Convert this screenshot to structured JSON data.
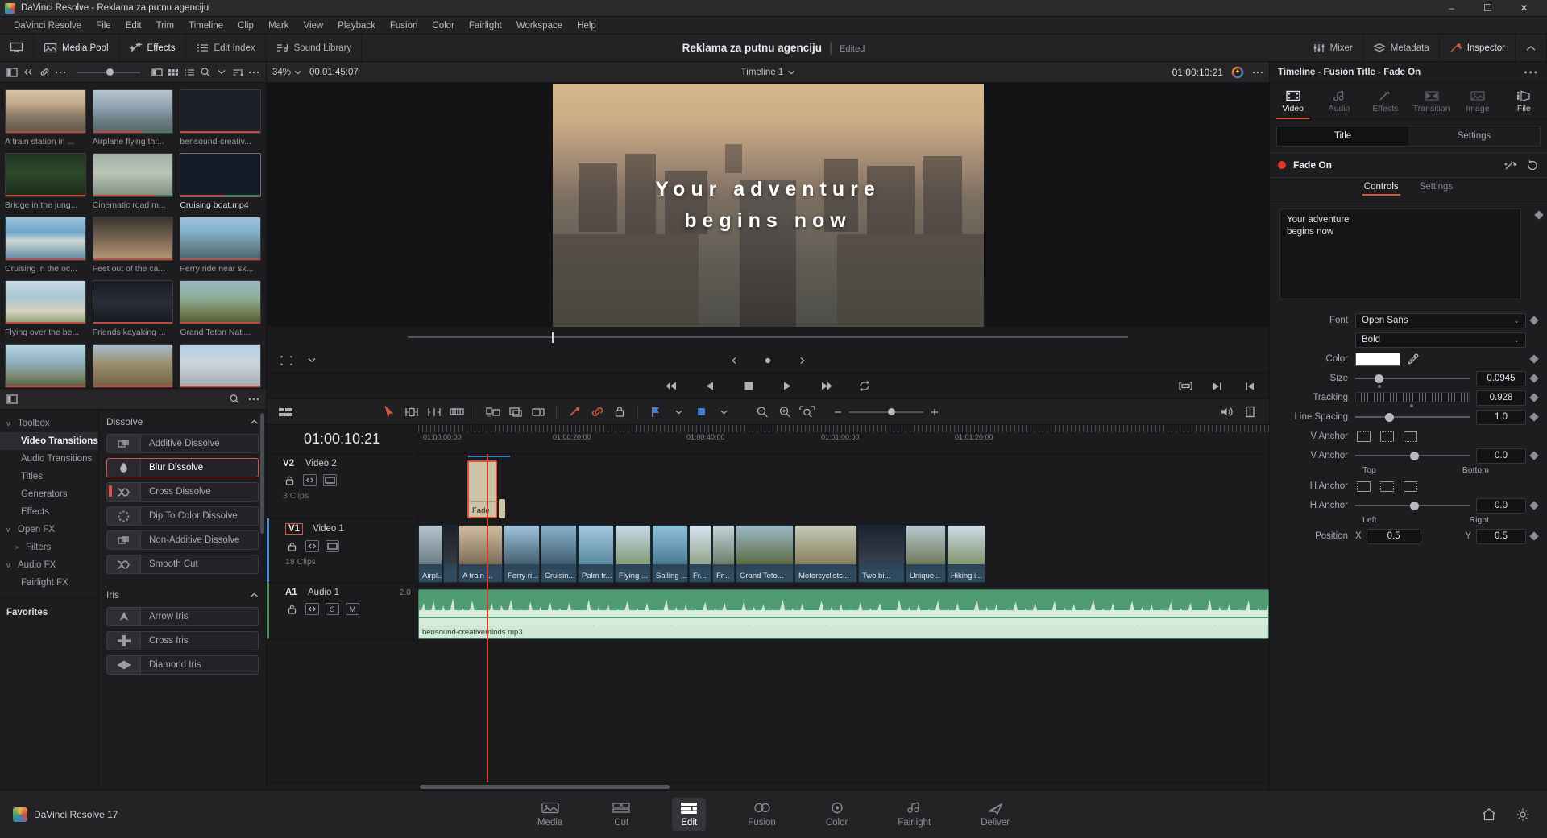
{
  "window": {
    "title": "DaVinci Resolve - Reklama za putnu agenciju",
    "minimize": "–",
    "maximize": "☐",
    "close": "✕"
  },
  "menubar": [
    "DaVinci Resolve",
    "File",
    "Edit",
    "Trim",
    "Timeline",
    "Clip",
    "Mark",
    "View",
    "Playback",
    "Fusion",
    "Color",
    "Fairlight",
    "Workspace",
    "Help"
  ],
  "apptoolbar": {
    "items": [
      {
        "label": "",
        "icon": "viewer-icon",
        "active": false
      },
      {
        "label": "Media Pool",
        "icon": "media-pool-icon",
        "active": true
      },
      {
        "label": "Effects",
        "icon": "effects-icon",
        "active": true
      },
      {
        "label": "Edit Index",
        "icon": "edit-index-icon",
        "active": false
      },
      {
        "label": "Sound Library",
        "icon": "sound-library-icon",
        "active": false
      }
    ],
    "right_items": [
      {
        "label": "Mixer",
        "icon": "mixer-icon"
      },
      {
        "label": "Metadata",
        "icon": "metadata-icon"
      },
      {
        "label": "Inspector",
        "icon": "inspector-icon"
      }
    ],
    "project_name": "Reklama za putnu agenciju",
    "project_status": "Edited"
  },
  "media_pool": {
    "zoom": "34%",
    "clips": [
      {
        "name": "A train station in ...",
        "selected": false
      },
      {
        "name": "Airplane flying thr...",
        "selected": false
      },
      {
        "name": "bensound-creativ...",
        "selected": false
      },
      {
        "name": "Bridge in the jung...",
        "selected": false
      },
      {
        "name": "Cinematic road m...",
        "selected": false
      },
      {
        "name": "Cruising boat.mp4",
        "selected": true
      },
      {
        "name": "Cruising in the oc...",
        "selected": false
      },
      {
        "name": "Feet out of the ca...",
        "selected": false
      },
      {
        "name": "Ferry ride near sk...",
        "selected": false
      },
      {
        "name": "Flying over the be...",
        "selected": false
      },
      {
        "name": "Friends kayaking ...",
        "selected": false
      },
      {
        "name": "Grand Teton Nati...",
        "selected": false
      }
    ]
  },
  "effects_library": {
    "tree": [
      {
        "label": "Toolbox",
        "level": 0,
        "chevron": "v",
        "selected": false
      },
      {
        "label": "Video Transitions",
        "level": 1,
        "chevron": "",
        "selected": true
      },
      {
        "label": "Audio Transitions",
        "level": 1,
        "chevron": "",
        "selected": false
      },
      {
        "label": "Titles",
        "level": 1,
        "chevron": "",
        "selected": false
      },
      {
        "label": "Generators",
        "level": 1,
        "chevron": "",
        "selected": false
      },
      {
        "label": "Effects",
        "level": 1,
        "chevron": "",
        "selected": false
      },
      {
        "label": "Open FX",
        "level": 0,
        "chevron": "v",
        "selected": false
      },
      {
        "label": "Filters",
        "level": 1,
        "chevron": ">",
        "selected": false
      },
      {
        "label": "Audio FX",
        "level": 0,
        "chevron": "v",
        "selected": false
      },
      {
        "label": "Fairlight FX",
        "level": 1,
        "chevron": "",
        "selected": false
      }
    ],
    "favorites_label": "Favorites",
    "categories": [
      {
        "name": "Dissolve",
        "items": [
          {
            "label": "Additive Dissolve",
            "icon": "additive-dissolve-icon",
            "selected": false,
            "marker": false
          },
          {
            "label": "Blur Dissolve",
            "icon": "blur-dissolve-icon",
            "selected": true,
            "marker": false
          },
          {
            "label": "Cross Dissolve",
            "icon": "cross-dissolve-icon",
            "selected": false,
            "marker": true
          },
          {
            "label": "Dip To Color Dissolve",
            "icon": "dip-to-color-icon",
            "selected": false,
            "marker": false
          },
          {
            "label": "Non-Additive Dissolve",
            "icon": "non-additive-icon",
            "selected": false,
            "marker": false
          },
          {
            "label": "Smooth Cut",
            "icon": "smooth-cut-icon",
            "selected": false,
            "marker": false
          }
        ]
      },
      {
        "name": "Iris",
        "items": [
          {
            "label": "Arrow Iris",
            "icon": "arrow-iris-icon",
            "selected": false,
            "marker": false
          },
          {
            "label": "Cross Iris",
            "icon": "cross-iris-icon",
            "selected": false,
            "marker": false
          },
          {
            "label": "Diamond Iris",
            "icon": "diamond-iris-icon",
            "selected": false,
            "marker": false
          }
        ]
      }
    ]
  },
  "viewer": {
    "zoom": "34%",
    "duration_tc": "00:01:45:07",
    "timeline_name": "Timeline 1",
    "current_tc": "01:00:10:21",
    "title_line1": "Your adventure",
    "title_line2": "begins now"
  },
  "timeline": {
    "timecode": "01:00:10:21",
    "ruler_labels": [
      "01:00:00:00",
      "01:00:20:00",
      "01:00:40:00",
      "01:01:00:00",
      "01:01:20:00"
    ],
    "tracks": [
      {
        "id": "V2",
        "name": "Video 2",
        "clips_count": "3 Clips",
        "level": "",
        "selected": false
      },
      {
        "id": "V1",
        "name": "Video 1",
        "clips_count": "18 Clips",
        "level": "",
        "selected": true
      },
      {
        "id": "A1",
        "name": "Audio 1",
        "clips_count": "",
        "level": "2.0",
        "selected": false
      }
    ],
    "v2_clip_label": "Fade",
    "v2_clip_label2": "..",
    "v1_clips": [
      "Airpl...",
      "A train ...",
      "Ferry ri...",
      "Cruisin...",
      "Palm tr...",
      "Flying ...",
      "Sailing ...",
      "Fr...",
      "Fr...",
      "Grand Teto...",
      "Motorcyclists...",
      "Two bi...",
      "Unique...",
      "Hiking i..."
    ],
    "audio_clip_label": "bensound-creativeminds.mp3"
  },
  "inspector": {
    "header": "Timeline - Fusion Title - Fade On",
    "tabs": [
      {
        "label": "Video",
        "icon": "video-icon",
        "active": true,
        "enabled": true
      },
      {
        "label": "Audio",
        "icon": "audio-icon",
        "active": false,
        "enabled": false
      },
      {
        "label": "Effects",
        "icon": "effects-icon",
        "active": false,
        "enabled": false
      },
      {
        "label": "Transition",
        "icon": "transition-icon",
        "active": false,
        "enabled": false
      },
      {
        "label": "Image",
        "icon": "image-icon",
        "active": false,
        "enabled": false
      },
      {
        "label": "File",
        "icon": "file-icon",
        "active": false,
        "enabled": true
      }
    ],
    "segments": [
      {
        "label": "Title",
        "active": true
      },
      {
        "label": "Settings",
        "active": false
      }
    ],
    "effect_name": "Fade On",
    "sub_tabs": [
      {
        "label": "Controls",
        "active": true
      },
      {
        "label": "Settings",
        "active": false
      }
    ],
    "text_value": "Your adventure\nbegins now",
    "properties": {
      "font_label": "Font",
      "font_value": "Open Sans",
      "font_style_value": "Bold",
      "color_label": "Color",
      "color_value": "#ffffff",
      "size_label": "Size",
      "size_value": "0.0945",
      "tracking_label": "Tracking",
      "tracking_value": "0.928",
      "line_spacing_label": "Line Spacing",
      "line_spacing_value": "1.0",
      "v_anchor_label": "V Anchor",
      "v_anchor_value": "0.0",
      "v_anchor_min": "Top",
      "v_anchor_max": "Bottom",
      "h_anchor_label": "H Anchor",
      "h_anchor_value": "0.0",
      "h_anchor_min": "Left",
      "h_anchor_max": "Right",
      "position_label": "Position",
      "position_x_label": "X",
      "position_x_value": "0.5",
      "position_y_label": "Y",
      "position_y_value": "0.5"
    }
  },
  "bottombar": {
    "version": "DaVinci Resolve 17",
    "pages": [
      {
        "label": "Media",
        "icon": "media-page-icon",
        "active": false
      },
      {
        "label": "Cut",
        "icon": "cut-page-icon",
        "active": false
      },
      {
        "label": "Edit",
        "icon": "edit-page-icon",
        "active": true
      },
      {
        "label": "Fusion",
        "icon": "fusion-page-icon",
        "active": false
      },
      {
        "label": "Color",
        "icon": "color-page-icon",
        "active": false
      },
      {
        "label": "Fairlight",
        "icon": "fairlight-page-icon",
        "active": false
      },
      {
        "label": "Deliver",
        "icon": "deliver-page-icon",
        "active": false
      }
    ],
    "right_icons": [
      "home-icon",
      "settings-icon"
    ]
  },
  "colors": {
    "accent": "#d8563e",
    "playhead": "#e0382b",
    "v1_track": "#4a8fd0",
    "a1_track": "#3d8d5e"
  }
}
